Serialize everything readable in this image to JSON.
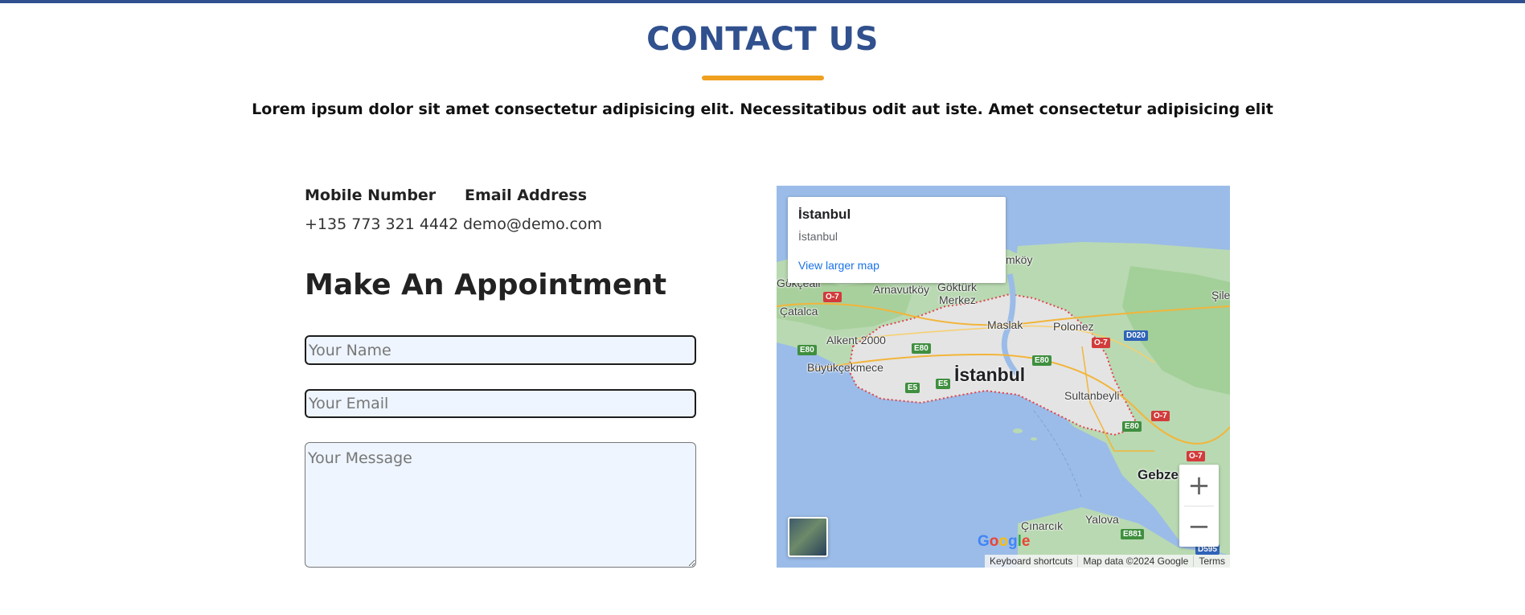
{
  "header": {
    "title": "CONTACT US",
    "subtitle": "Lorem ipsum dolor sit amet consectetur adipisicing elit. Necessitatibus odit aut iste. Amet consectetur adipisicing elit",
    "accent_color": "#f0a020",
    "title_color": "#30508e"
  },
  "contact": {
    "mobile_label": "Mobile Number",
    "mobile_value": "+135 773 321 4442",
    "email_label": "Email Address",
    "email_value": "demo@demo.com"
  },
  "form": {
    "heading": "Make An Appointment",
    "name_placeholder": "Your Name",
    "email_placeholder": "Your Email",
    "message_placeholder": "Your Message"
  },
  "map": {
    "card_title": "İstanbul",
    "card_subtitle": "İstanbul",
    "card_link": "View larger map",
    "zoom_in": "+",
    "zoom_out": "−",
    "google": "Google",
    "attribution": {
      "shortcuts": "Keyboard shortcuts",
      "data": "Map data ©2024 Google",
      "terms": "Terms"
    },
    "labels": {
      "istanbul": "İstanbul",
      "gebze": "Gebze",
      "sultanbeyli": "Sultanbeyli",
      "polonez": "Polonez",
      "maslak": "Maslak",
      "arnavutkoy": "Arnavutköy",
      "gokturk": "Göktürk",
      "merkez": "Merkez",
      "catalca": "Çatalca",
      "gokceali": "Gökçeali",
      "alkent": "Alkent 2000",
      "buyukcekmece": "Büyükçekmece",
      "yalova": "Yalova",
      "cinarcik": "Çınarcık",
      "sile": "Şile",
      "koy": "mköy"
    },
    "shields": {
      "o7a": "O-7",
      "o7b": "O-7",
      "o7c": "O-7",
      "o7d": "O-7",
      "e80a": "E80",
      "e80b": "E80",
      "e80c": "E80",
      "e80d": "E80",
      "e5a": "E5",
      "e5b": "E5",
      "d020": "D020",
      "e881": "E881",
      "d595": "D595"
    }
  }
}
